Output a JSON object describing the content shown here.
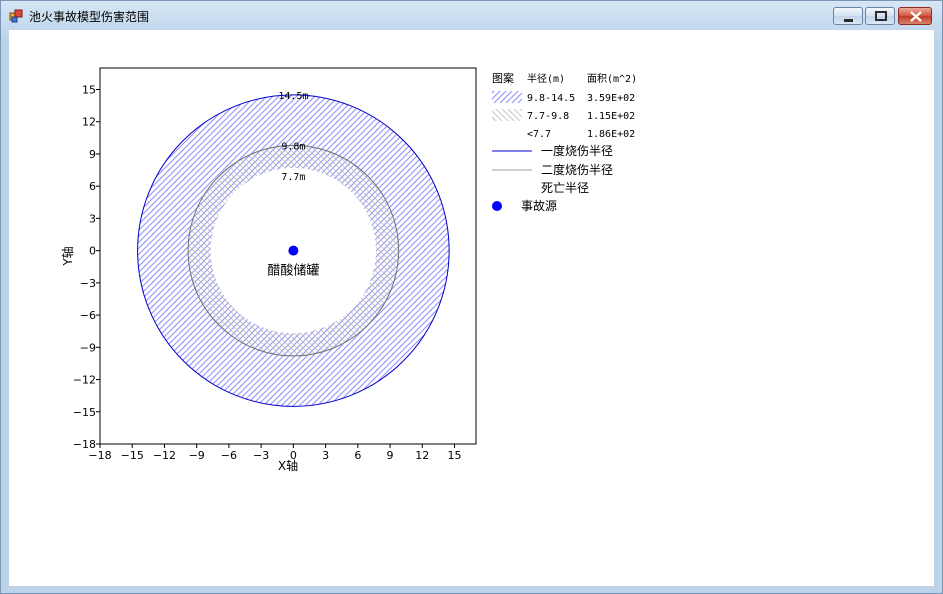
{
  "window": {
    "title": "池火事故模型伤害范围"
  },
  "icons": {
    "app": "app-window-icon",
    "minimize": "minimize-icon",
    "maximize": "maximize-icon",
    "close": "close-icon"
  },
  "colors": {
    "first_degree": "#0000cc",
    "second_degree": "#a0a0a0",
    "first_hatch": "#8c8cff",
    "second_hatch": "#c8c8c8",
    "source": "#0000ff"
  },
  "chart_data": {
    "type": "scatter",
    "xlabel": "X轴",
    "ylabel": "Y轴",
    "xlim": [
      -18,
      17
    ],
    "ylim": [
      -18,
      17
    ],
    "xticks": [
      -18,
      -15,
      -12,
      -9,
      -6,
      -3,
      0,
      3,
      6,
      9,
      12,
      15
    ],
    "yticks": [
      -18,
      -15,
      -12,
      -9,
      -6,
      -3,
      0,
      3,
      6,
      9,
      12,
      15
    ],
    "grid": false,
    "legend_position": "right",
    "circles": [
      {
        "key": "first",
        "radius": 14.5,
        "label": "14.5m"
      },
      {
        "key": "second",
        "radius": 9.8,
        "label": "9.8m"
      },
      {
        "key": "death",
        "radius": 7.7,
        "label": "7.7m"
      }
    ],
    "source_point": {
      "x": 0,
      "y": 0,
      "label": "醋酸储罐"
    },
    "legend": {
      "header": {
        "col1": "图案",
        "col2": "半径(m)",
        "col3": "面积(m^2)"
      },
      "zones": [
        {
          "range": "9.8-14.5",
          "area": "3.59E+02"
        },
        {
          "range": "7.7-9.8",
          "area": "1.15E+02"
        },
        {
          "range": "<7.7",
          "area": "1.86E+02"
        }
      ],
      "lines": [
        {
          "label": "一度烧伤半径"
        },
        {
          "label": "二度烧伤半径"
        },
        {
          "label": "死亡半径"
        }
      ],
      "source_label": "事故源"
    }
  }
}
